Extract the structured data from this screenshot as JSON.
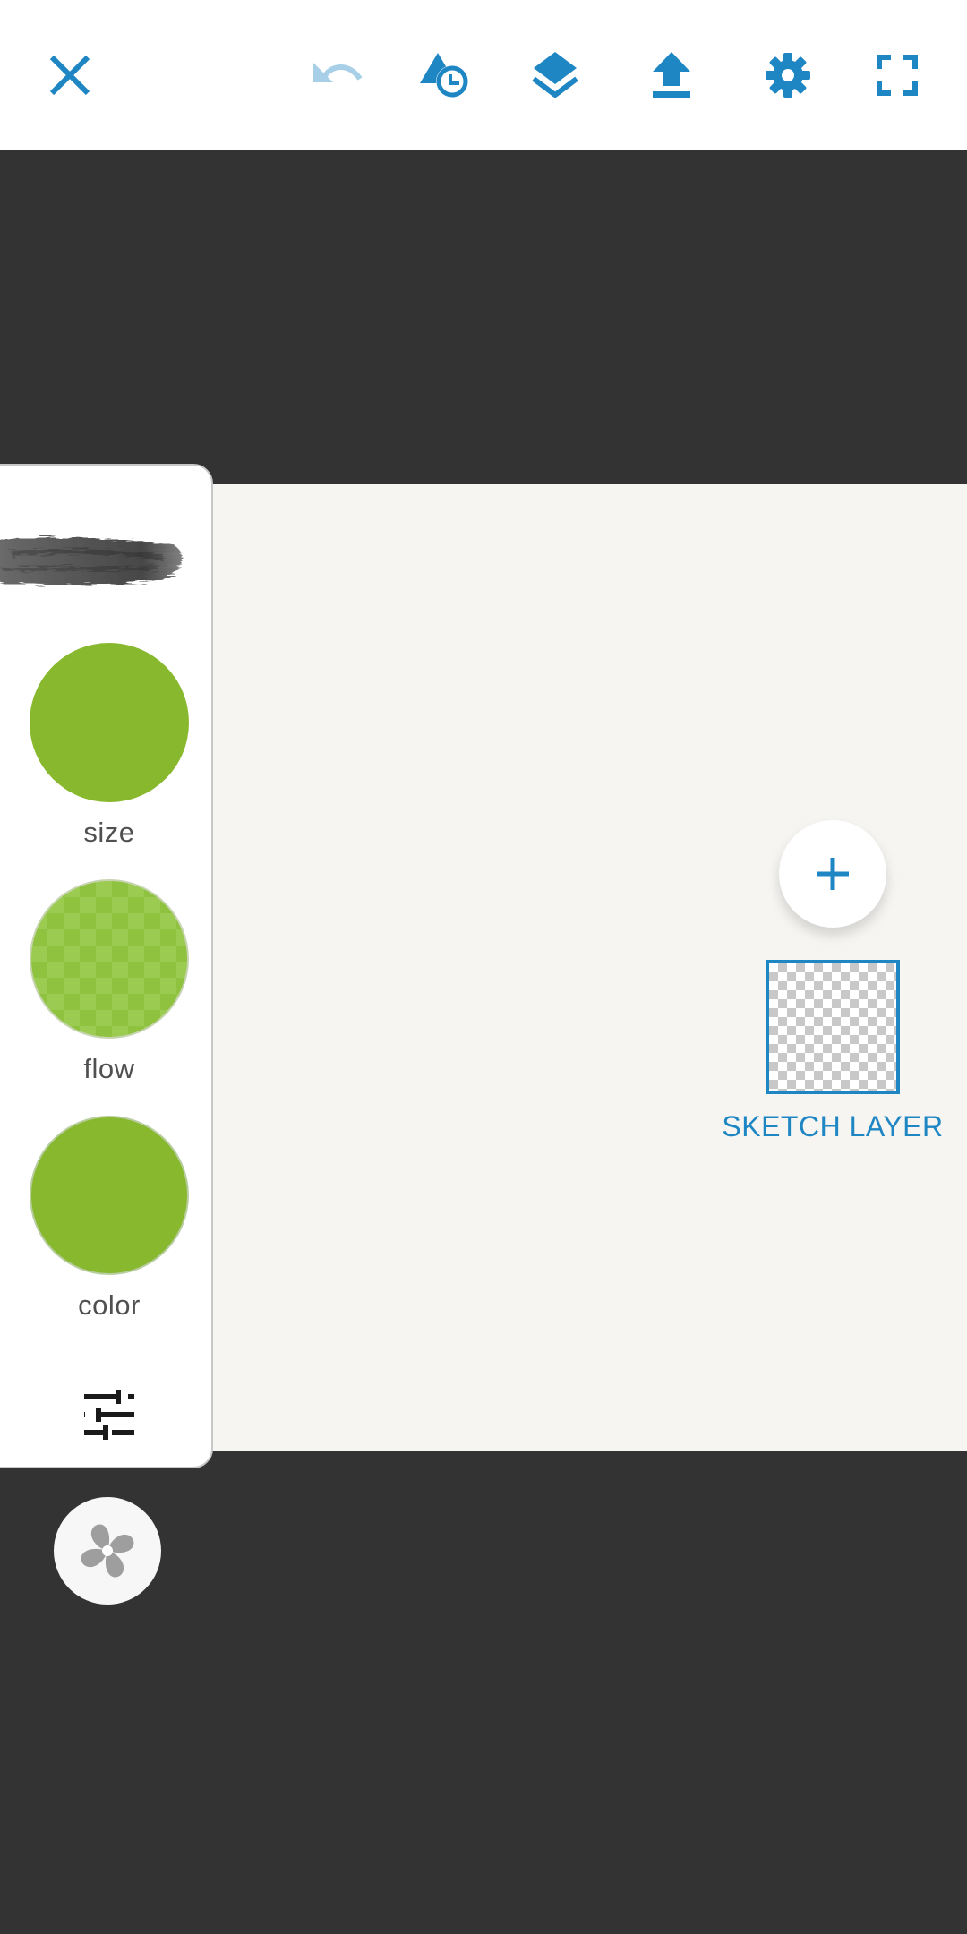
{
  "toolbar": {
    "close_icon": "close-icon",
    "undo_icon": "undo-icon",
    "shapes_icon": "shapes-icon",
    "layers_icon": "layers-icon",
    "upload_icon": "upload-icon",
    "settings_icon": "settings-icon",
    "fullscreen_icon": "fullscreen-icon",
    "accent_color": "#1f86c4",
    "disabled_color": "#a7cfe8"
  },
  "brush_panel": {
    "brush_color": "#88b82d",
    "size_label": "size",
    "flow_label": "flow",
    "color_label": "color",
    "adjust_icon": "sliders-icon"
  },
  "tools_fab": {
    "icon": "fan-icon"
  },
  "layers": {
    "add_icon": "plus-icon",
    "layer_name": "SKETCH LAYER"
  }
}
